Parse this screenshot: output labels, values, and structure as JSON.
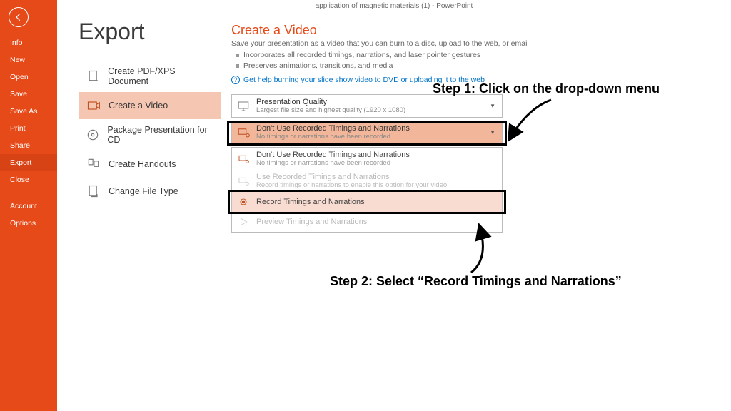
{
  "titlebar": "application of magnetic materials (1) - PowerPoint",
  "sidebar": {
    "items": [
      "Info",
      "New",
      "Open",
      "Save",
      "Save As",
      "Print",
      "Share",
      "Export",
      "Close"
    ],
    "bottom": [
      "Account",
      "Options"
    ],
    "selected": "Export"
  },
  "page_heading": "Export",
  "export_options": [
    {
      "label": "Create PDF/XPS Document",
      "icon": "pdf"
    },
    {
      "label": "Create a Video",
      "icon": "video",
      "selected": true
    },
    {
      "label": "Package Presentation for CD",
      "icon": "cd"
    },
    {
      "label": "Create Handouts",
      "icon": "handout"
    },
    {
      "label": "Change File Type",
      "icon": "filetype"
    }
  ],
  "detail": {
    "heading": "Create a Video",
    "subtitle": "Save your presentation as a video that you can burn to a disc, upload to the web, or email",
    "bullets": [
      "Incorporates all recorded timings, narrations, and laser pointer gestures",
      "Preserves animations, transitions, and media"
    ],
    "help_link": "Get help burning your slide show video to DVD or uploading it to the web",
    "quality": {
      "title": "Presentation Quality",
      "sub": "Largest file size and highest quality (1920 x 1080)"
    },
    "timings": {
      "title": "Don't Use Recorded Timings and Narrations",
      "sub": "No timings or narrations have been recorded"
    },
    "menu": [
      {
        "title": "Don't Use Recorded Timings and Narrations",
        "sub": "No timings or narrations have been recorded",
        "disabled": false
      },
      {
        "title": "Use Recorded Timings and Narrations",
        "sub": "Record timings or narrations to enable this option for your video.",
        "disabled": true
      },
      {
        "title": "Record Timings and Narrations",
        "sub": "",
        "hover": true
      },
      {
        "title": "Preview Timings and Narrations",
        "sub": "",
        "disabled": true
      }
    ]
  },
  "annotations": {
    "step1": "Step 1: Click on the drop-down menu",
    "step2": "Step 2: Select “Record Timings and Narrations”"
  }
}
